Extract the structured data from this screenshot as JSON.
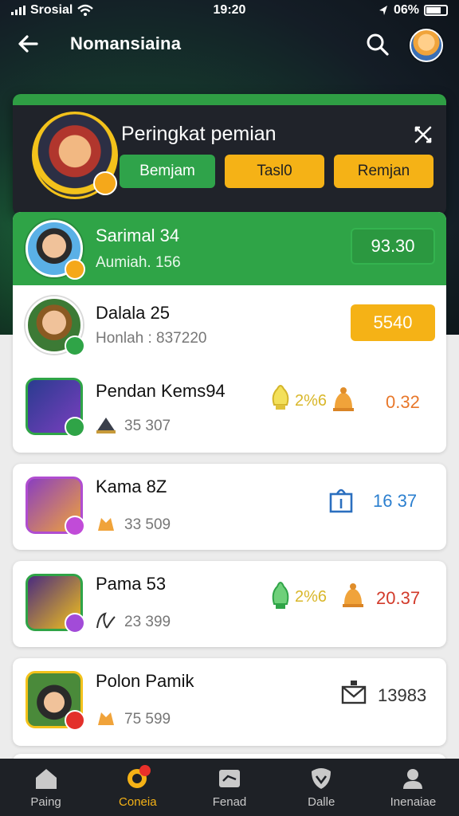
{
  "status": {
    "carrier": "Srosial",
    "time": "19:20",
    "battery": "06%"
  },
  "header": {
    "title": "Nomansiaina"
  },
  "panel": {
    "title": "Peringkat pemian",
    "tabs": [
      {
        "label": "Bemjam"
      },
      {
        "label": "Tasl0"
      },
      {
        "label": "Remjan"
      }
    ]
  },
  "rows": [
    {
      "name": "Sarimal 34",
      "sub": "Aumiah. 156",
      "score": "93.30"
    },
    {
      "name": "Dalala 25",
      "sub": "Honlah : 837220",
      "score": "5540"
    },
    {
      "name": "Pendan Kems94",
      "sub": "35 307",
      "badge": "2%6",
      "score": "0.32"
    },
    {
      "name": "Kama 8Z",
      "sub": "33 509",
      "score": "16 37"
    },
    {
      "name": "Pama 53",
      "sub": "23 399",
      "badge": "2%6",
      "score": "20.37"
    },
    {
      "name": "Polon Pamik",
      "sub": "75 599",
      "score": "13983"
    }
  ],
  "bottom_nav": [
    {
      "label": "Paing",
      "icon": "home-icon"
    },
    {
      "label": "Coneia",
      "icon": "trophy-icon"
    },
    {
      "label": "Fenad",
      "icon": "card-icon"
    },
    {
      "label": "Dalle",
      "icon": "shield-icon"
    },
    {
      "label": "Inenaiae",
      "icon": "user-icon"
    }
  ],
  "colors": {
    "green": "#2fa447",
    "yellow": "#f5b216",
    "dark": "#20232a"
  }
}
